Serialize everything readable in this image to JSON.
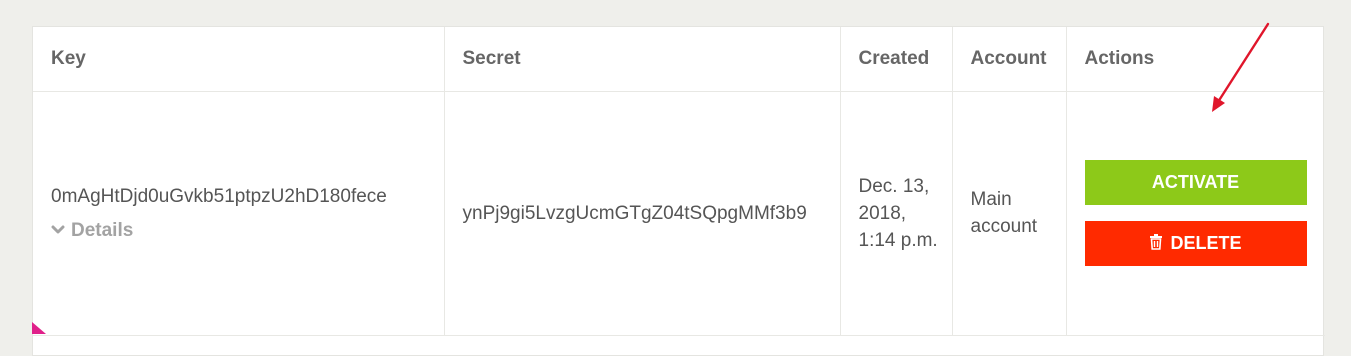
{
  "table": {
    "headers": {
      "key": "Key",
      "secret": "Secret",
      "created": "Created",
      "account": "Account",
      "actions": "Actions"
    },
    "rows": [
      {
        "key": "0mAgHtDjd0uGvkb51ptpzU2hD180fece",
        "details_label": "Details",
        "secret": "ynPj9gi5LvzgUcmGTgZ04tSQpgMMf3b9",
        "created": "Dec. 13, 2018, 1:14 p.m.",
        "account": "Main account",
        "activate_label": "ACTIVATE",
        "delete_label": "DELETE"
      }
    ]
  },
  "colors": {
    "activate_button": "#8dc919",
    "delete_button": "#ff2a00",
    "annotation_arrow": "#e0162b",
    "corner_marker": "#e0208a"
  },
  "icons": {
    "details": "chevron-down-icon",
    "delete": "trash-icon"
  }
}
